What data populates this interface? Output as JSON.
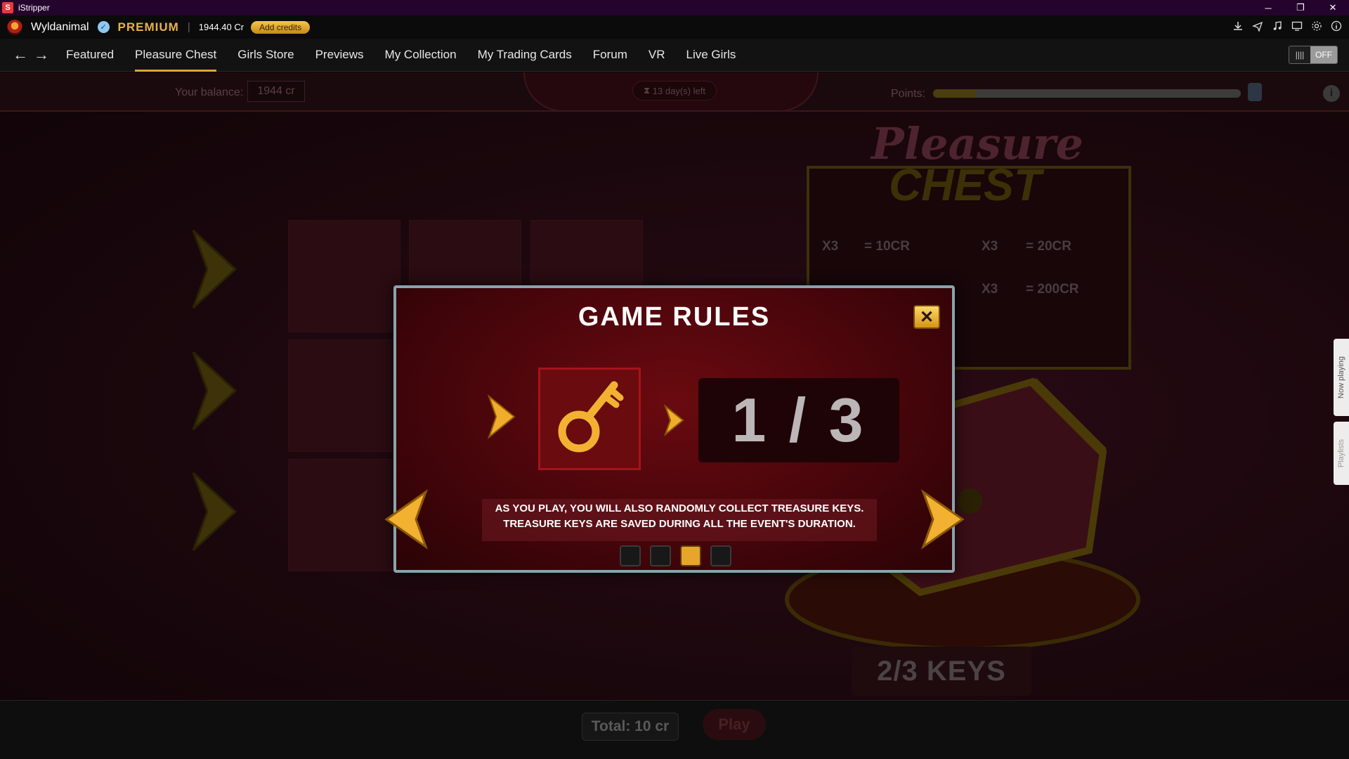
{
  "window": {
    "title": "iStripper",
    "minimize": "─",
    "restore": "❐",
    "close": "✕"
  },
  "account": {
    "username": "Wyldanimal",
    "tier": "PREMIUM",
    "credits": "1944.40 Cr",
    "add_credits_label": "Add credits"
  },
  "nav": {
    "back_icon": "←",
    "forward_icon": "→",
    "items": [
      {
        "label": "Featured"
      },
      {
        "label": "Pleasure Chest",
        "active": true
      },
      {
        "label": "Girls Store"
      },
      {
        "label": "Previews"
      },
      {
        "label": "My Collection"
      },
      {
        "label": "My Trading Cards"
      },
      {
        "label": "Forum"
      },
      {
        "label": "VR"
      },
      {
        "label": "Live Girls"
      }
    ],
    "toggle_label": "OFF"
  },
  "game": {
    "balance_label": "Your balance:",
    "balance_value": "1944 cr",
    "days_left": "13 day(s) left",
    "points_label": "Points:",
    "points_progress": 0.14,
    "logo_line1": "Pleasure",
    "logo_line2": "CHEST",
    "prizes": [
      {
        "qty": "X3",
        "value": "= 10CR"
      },
      {
        "qty": "X3",
        "value": "= 20CR"
      },
      {
        "qty": "X3",
        "value": "= 200CR"
      }
    ],
    "keys_status": "2/3 KEYS",
    "total": "Total: 10 cr",
    "play_label": "Play"
  },
  "side_tabs": {
    "now_playing": "Now playing",
    "playlists": "Playlists"
  },
  "modal": {
    "title": "GAME RULES",
    "close_icon": "✕",
    "counter": "1 / 3",
    "description_line1": "AS YOU PLAY, YOU WILL ALSO RANDOMLY COLLECT TREASURE KEYS.",
    "description_line2": "TREASURE KEYS ARE SAVED DURING ALL THE EVENT'S DURATION.",
    "pages": 4,
    "active_page": 3
  },
  "colors": {
    "accent_gold": "#e2a33a",
    "modal_border": "#8aa3ae",
    "modal_red": "#6a0a10"
  }
}
